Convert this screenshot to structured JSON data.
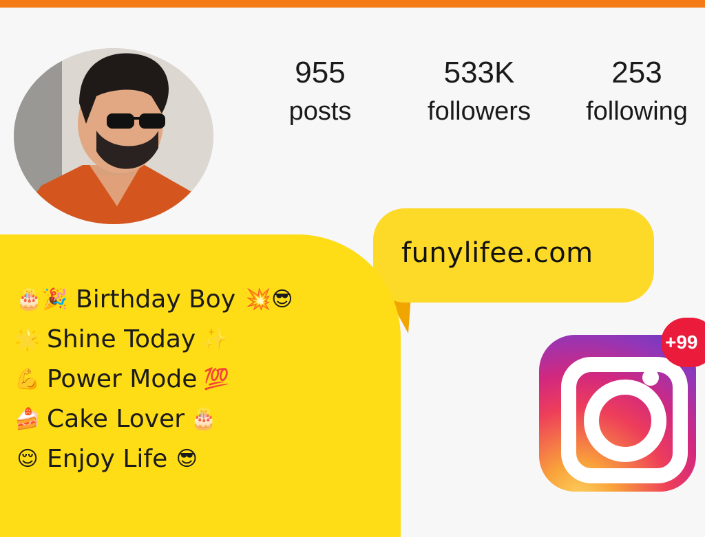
{
  "profile": {
    "stats": {
      "posts": {
        "value": "955",
        "label": "posts"
      },
      "followers": {
        "value": "533K",
        "label": "followers"
      },
      "following": {
        "value": "253",
        "label": "following"
      }
    },
    "website": "funylifee.com"
  },
  "bio": [
    {
      "pre": "🎂🎉",
      "text": "Birthday Boy",
      "post": "💥😎"
    },
    {
      "pre": "🌟",
      "text": "Shine Today",
      "post": "✨"
    },
    {
      "pre": "💪",
      "text": "Power Mode",
      "post": "💯"
    },
    {
      "pre": "🍰",
      "text": "Cake Lover",
      "post": "🎂"
    },
    {
      "pre": "😌",
      "text": "Enjoy Life",
      "post": "😎"
    }
  ],
  "notification_badge": "+99",
  "icons": {
    "avatar": "profile-photo",
    "logo": "instagram-icon"
  },
  "colors": {
    "top_bar": "#f47b16",
    "bubble": "#fedc16",
    "badge": "#ea1b3b"
  }
}
